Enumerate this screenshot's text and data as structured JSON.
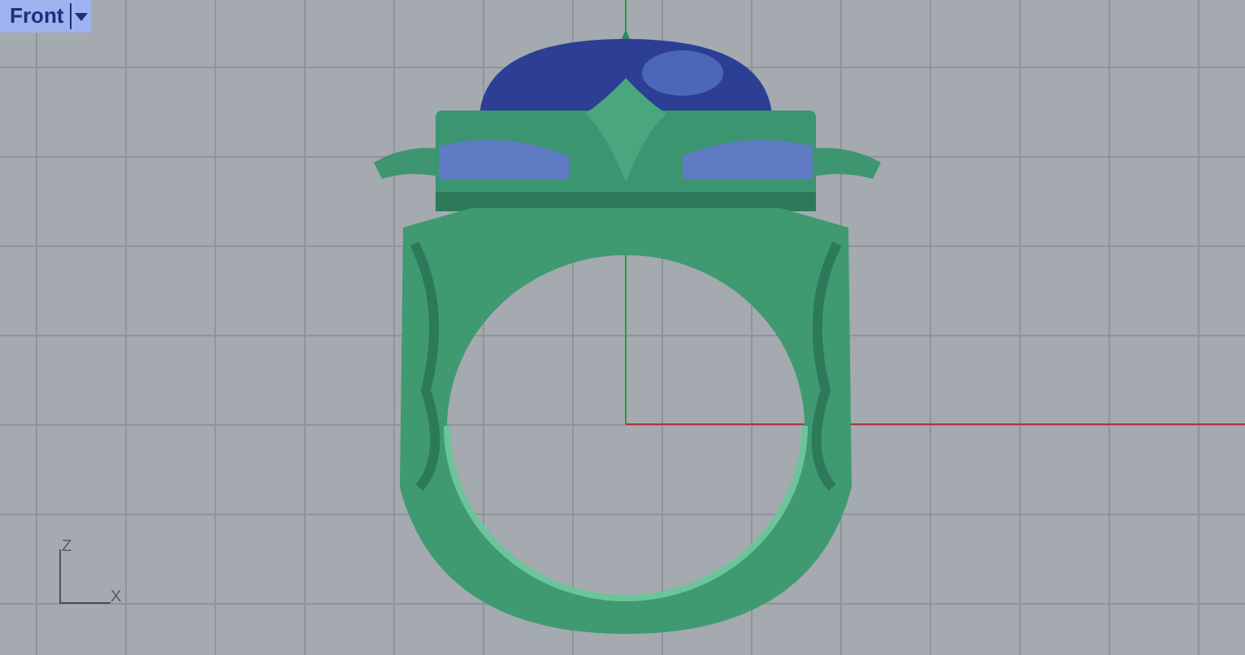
{
  "viewport": {
    "title": "Front",
    "axis_labels": [
      "Z",
      "X"
    ]
  }
}
